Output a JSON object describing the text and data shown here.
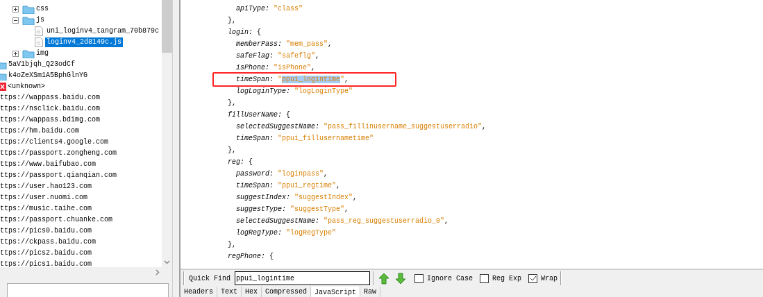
{
  "tree": [
    {
      "kind": "hidden-parent",
      "children": [
        {
          "kind": "folder",
          "label": "css",
          "expanded": false
        },
        {
          "kind": "folder",
          "label": "js",
          "expanded": true,
          "children": [
            {
              "kind": "js-file",
              "label": "uni_loginv4_tangram_70b879c",
              "selected": false
            },
            {
              "kind": "js-file",
              "label": "loginv4_2d8149c.js",
              "selected": true
            }
          ]
        },
        {
          "kind": "folder",
          "label": "img",
          "expanded": false
        }
      ]
    },
    {
      "kind": "root-folder",
      "label": "5aV1bjqh_Q23odCf"
    },
    {
      "kind": "root-folder",
      "label": "k4oZeXSm1A5BphGlnYG"
    },
    {
      "kind": "error",
      "label": "<unknown>"
    },
    {
      "kind": "host",
      "label": "ttps://wappass.baidu.com"
    },
    {
      "kind": "host",
      "label": "ttps://nsclick.baidu.com"
    },
    {
      "kind": "host",
      "label": "ttps://wappass.bdimg.com"
    },
    {
      "kind": "host",
      "label": "ttps://hm.baidu.com"
    },
    {
      "kind": "host",
      "label": "ttps://clients4.google.com"
    },
    {
      "kind": "host",
      "label": "ttps://passport.zongheng.com"
    },
    {
      "kind": "host",
      "label": "ttps://www.baifubao.com"
    },
    {
      "kind": "host",
      "label": "ttps://passport.qianqian.com"
    },
    {
      "kind": "host",
      "label": "ttps://user.hao123.com"
    },
    {
      "kind": "host",
      "label": "ttps://user.nuomi.com"
    },
    {
      "kind": "host",
      "label": "ttps://music.taihe.com"
    },
    {
      "kind": "host",
      "label": "ttps://passport.chuanke.com"
    },
    {
      "kind": "host",
      "label": "ttps://pics0.baidu.com"
    },
    {
      "kind": "host",
      "label": "ttps://ckpass.baidu.com"
    },
    {
      "kind": "host",
      "label": "ttps://pics2.baidu.com"
    },
    {
      "kind": "host",
      "label": "ttps://pics1.baidu.com"
    }
  ],
  "code_lines": [
    {
      "parts": [
        {
          "kind": "key",
          "text": "    apiType:"
        },
        {
          "kind": "string",
          "text": " \"class\""
        }
      ]
    },
    {
      "parts": [
        {
          "kind": "punct",
          "text": "  },"
        }
      ]
    },
    {
      "parts": [
        {
          "kind": "key",
          "text": "  login:"
        },
        {
          "kind": "punct",
          "text": " {"
        }
      ]
    },
    {
      "parts": [
        {
          "kind": "key",
          "text": "    memberPass:"
        },
        {
          "kind": "string",
          "text": " \"mem_pass\""
        },
        {
          "kind": "punct",
          "text": ","
        }
      ]
    },
    {
      "parts": [
        {
          "kind": "key",
          "text": "    safeFlag:"
        },
        {
          "kind": "string",
          "text": " \"safeflg\""
        },
        {
          "kind": "punct",
          "text": ","
        }
      ]
    },
    {
      "parts": [
        {
          "kind": "key",
          "text": "    isPhone:"
        },
        {
          "kind": "string",
          "text": " \"isPhone\""
        },
        {
          "kind": "punct",
          "text": ","
        }
      ]
    },
    {
      "parts": [
        {
          "kind": "key",
          "text": "    timeSpan:"
        },
        {
          "kind": "string",
          "text": " \""
        },
        {
          "kind": "string",
          "text": "ppui_logintime",
          "highlighted": true
        },
        {
          "kind": "string",
          "text": "\""
        },
        {
          "kind": "punct",
          "text": ","
        }
      ],
      "boxed": true
    },
    {
      "parts": [
        {
          "kind": "key",
          "text": "    logLoginType:"
        },
        {
          "kind": "string",
          "text": " \"logLoginType\""
        }
      ]
    },
    {
      "parts": [
        {
          "kind": "punct",
          "text": "  },"
        }
      ]
    },
    {
      "parts": [
        {
          "kind": "key",
          "text": "  fillUserName:"
        },
        {
          "kind": "punct",
          "text": " {"
        }
      ]
    },
    {
      "parts": [
        {
          "kind": "key",
          "text": "    selectedSuggestName:"
        },
        {
          "kind": "string",
          "text": " \"pass_fillinusername_suggestuserradio\""
        },
        {
          "kind": "punct",
          "text": ","
        }
      ]
    },
    {
      "parts": [
        {
          "kind": "key",
          "text": "    timeSpan:"
        },
        {
          "kind": "string",
          "text": " \"ppui_fillusernametime\""
        }
      ]
    },
    {
      "parts": [
        {
          "kind": "punct",
          "text": "  },"
        }
      ]
    },
    {
      "parts": [
        {
          "kind": "key",
          "text": "  reg:"
        },
        {
          "kind": "punct",
          "text": " {"
        }
      ]
    },
    {
      "parts": [
        {
          "kind": "key",
          "text": "    password:"
        },
        {
          "kind": "string",
          "text": " \"loginpass\""
        },
        {
          "kind": "punct",
          "text": ","
        }
      ]
    },
    {
      "parts": [
        {
          "kind": "key",
          "text": "    timeSpan:"
        },
        {
          "kind": "string",
          "text": " \"ppui_regtime\""
        },
        {
          "kind": "punct",
          "text": ","
        }
      ]
    },
    {
      "parts": [
        {
          "kind": "key",
          "text": "    suggestIndex:"
        },
        {
          "kind": "string",
          "text": " \"suggestIndex\""
        },
        {
          "kind": "punct",
          "text": ","
        }
      ]
    },
    {
      "parts": [
        {
          "kind": "key",
          "text": "    suggestType:"
        },
        {
          "kind": "string",
          "text": " \"suggestType\""
        },
        {
          "kind": "punct",
          "text": ","
        }
      ]
    },
    {
      "parts": [
        {
          "kind": "key",
          "text": "    selectedSuggestName:"
        },
        {
          "kind": "string",
          "text": " \"pass_reg_suggestuserradio_0\""
        },
        {
          "kind": "punct",
          "text": ","
        }
      ]
    },
    {
      "parts": [
        {
          "kind": "key",
          "text": "    logRegType:"
        },
        {
          "kind": "string",
          "text": " \"logRegType\""
        }
      ]
    },
    {
      "parts": [
        {
          "kind": "punct",
          "text": "  },"
        }
      ]
    },
    {
      "parts": [
        {
          "kind": "key",
          "text": "  regPhone:"
        },
        {
          "kind": "punct",
          "text": " {"
        }
      ]
    }
  ],
  "find_bar": {
    "label": "Quick Find",
    "value": "ppui_logintime",
    "options": [
      {
        "label": "Ignore Case",
        "checked": false
      },
      {
        "label": "Reg Exp",
        "checked": false
      },
      {
        "label": "Wrap",
        "checked": true
      }
    ]
  },
  "tabs": [
    {
      "label": "Headers",
      "selected": false
    },
    {
      "label": "Text",
      "selected": false
    },
    {
      "label": "Hex",
      "selected": false
    },
    {
      "label": "Compressed",
      "selected": false
    },
    {
      "label": "JavaScript",
      "selected": true
    },
    {
      "label": "Raw",
      "selected": false
    }
  ]
}
